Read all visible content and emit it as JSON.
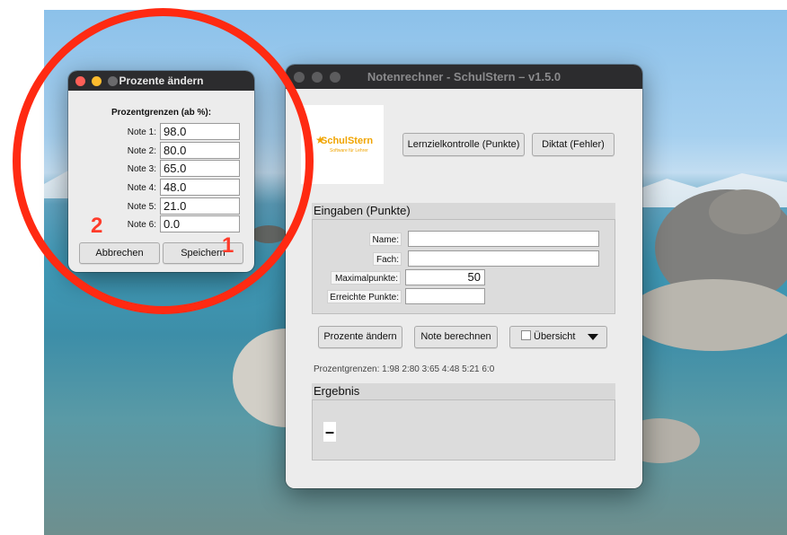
{
  "main_window": {
    "title": "Notenrechner - SchulStern  –  v1.5.0",
    "logo": {
      "text": "SchulStern",
      "subtitle": "Software für Lehrer"
    },
    "btn_lernziel": "Lernzielkontrolle (Punkte)",
    "btn_diktat": "Diktat (Fehler)",
    "inputs_section": {
      "header": "Eingaben (Punkte)",
      "name_label": "Name:",
      "name_value": "",
      "fach_label": "Fach:",
      "fach_value": "",
      "max_label": "Maximalpunkte:",
      "max_value": "50",
      "erreicht_label": "Erreichte Punkte:",
      "erreicht_value": ""
    },
    "btn_prozente": "Prozente ändern",
    "btn_note": "Note berechnen",
    "uebersicht_label": "Übersicht",
    "prozentgrenzen_text": "Prozentgrenzen:  1:98  2:80  3:65  4:48  5:21  6:0",
    "result_section": {
      "header": "Ergebnis",
      "value": "–"
    }
  },
  "dialog": {
    "title": "Prozente ändern",
    "heading": "Prozentgrenzen (ab %):",
    "notes": [
      {
        "label": "Note 1:",
        "value": "98.0"
      },
      {
        "label": "Note 2:",
        "value": "80.0"
      },
      {
        "label": "Note 3:",
        "value": "65.0"
      },
      {
        "label": "Note 4:",
        "value": "48.0"
      },
      {
        "label": "Note 5:",
        "value": "21.0"
      },
      {
        "label": "Note 6:",
        "value": "0.0"
      }
    ],
    "cancel_label": "Abbrechen",
    "save_label": "Speichern"
  },
  "annotations": {
    "marker_save": "1",
    "marker_cancel": "2",
    "ring_color": "#ff2a12"
  },
  "colors": {
    "traffic_close": "#ff5f57",
    "traffic_min": "#febc2e",
    "traffic_inactive": "#5c5c5e",
    "logo_accent": "#f0a400"
  }
}
